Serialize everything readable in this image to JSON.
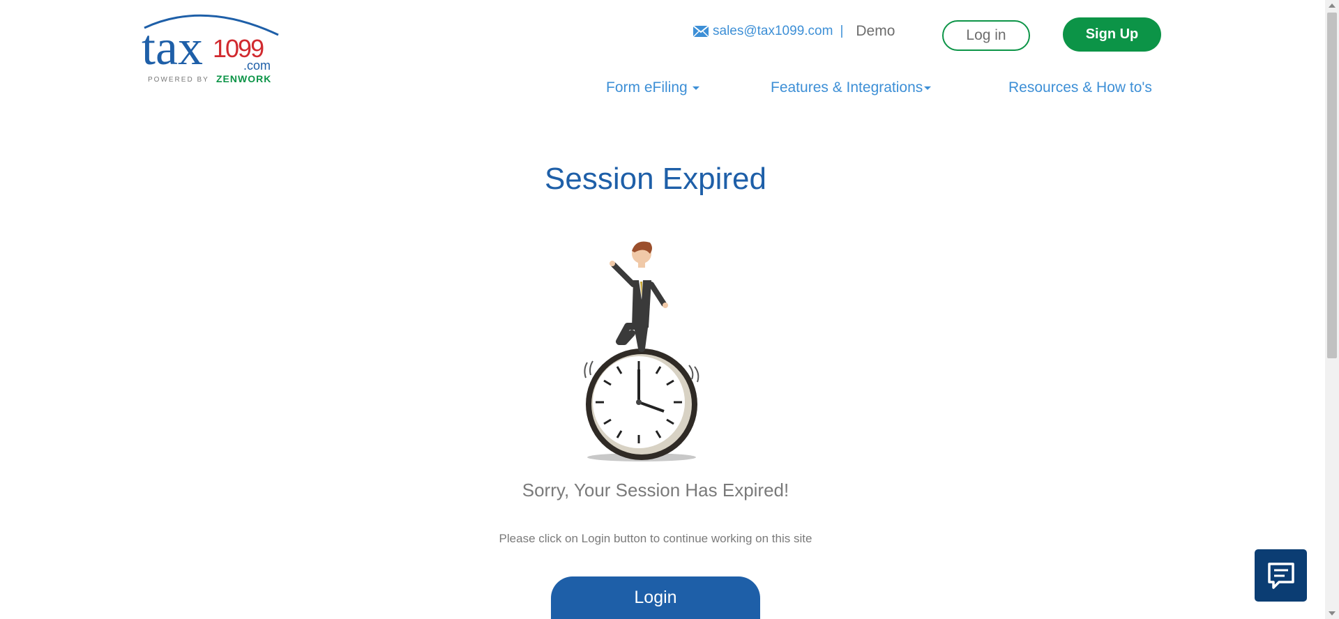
{
  "logo": {
    "brand_main": "tax",
    "brand_number": "1099",
    "brand_domain": ".com",
    "powered_by": "POWERED BY",
    "powered_brand": "ZENWORK"
  },
  "header": {
    "email": "sales@tax1099.com",
    "separator": "|",
    "demo": "Demo",
    "login_label": "Log in",
    "signup_label": "Sign Up"
  },
  "nav": {
    "items": [
      {
        "label": "Form eFiling"
      },
      {
        "label": "Features & Integrations"
      },
      {
        "label": "Resources & How to's"
      }
    ]
  },
  "main": {
    "title": "Session Expired",
    "message": "Sorry, Your Session Has Expired!",
    "hint": "Please click on Login button to continue working on this site",
    "login_button": "Login"
  },
  "colors": {
    "brand_blue": "#1e5fa8",
    "link_blue": "#3d8fd6",
    "brand_green": "#0c9447",
    "logo_red": "#d12a2f",
    "chat_navy": "#0b3d73"
  },
  "icons": {
    "mail": "envelope-icon",
    "chat": "chat-bubble-icon",
    "dropdown": "caret-down-icon"
  }
}
